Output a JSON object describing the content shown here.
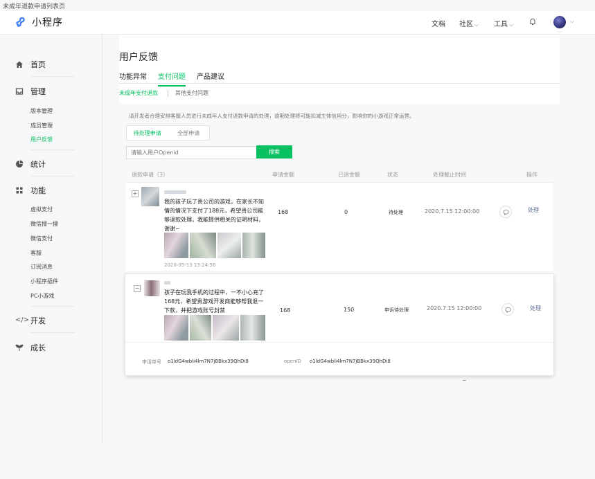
{
  "caption": "未成年退款申请列表页",
  "header": {
    "logo_text": "小程序",
    "links": [
      {
        "label": "文档",
        "has_dropdown": false
      },
      {
        "label": "社区",
        "has_dropdown": true
      },
      {
        "label": "工具",
        "has_dropdown": true
      }
    ],
    "bell_icon": "bell-icon",
    "avatar_icon": "user-avatar"
  },
  "sidebar": {
    "home": {
      "label": "首页",
      "icon": "home-icon"
    },
    "manage": {
      "label": "管理",
      "icon": "inbox-icon",
      "items": [
        "版本管理",
        "成员管理",
        "用户反馈"
      ],
      "active_index": 2
    },
    "stats": {
      "label": "统计",
      "icon": "pie-chart-icon"
    },
    "features": {
      "label": "功能",
      "icon": "grid-icon",
      "items": [
        "虚拟支付",
        "微信搜一搜",
        "微信支付",
        "客服",
        "订阅消息",
        "小程序插件",
        "PC小游戏"
      ]
    },
    "dev": {
      "label": "开发",
      "icon": "code-icon"
    },
    "growth": {
      "label": "成长",
      "icon": "sprout-icon"
    }
  },
  "main": {
    "title": "用户反馈",
    "tabs": [
      {
        "label": "功能异常",
        "active": false
      },
      {
        "label": "支付问题",
        "active": true
      },
      {
        "label": "产品建议",
        "active": false
      }
    ],
    "subtabs": [
      {
        "label": "未成年支付退款",
        "active": true
      },
      {
        "label": "其他支付问题",
        "active": false
      }
    ],
    "notice": "请开发者合理安排客服人员进行未成年人支付退款申请的处理，逾期处理将可能扣减主体信用分，影响你的小游戏正常运营。",
    "segments": [
      {
        "label": "待处理申请",
        "active": true
      },
      {
        "label": "全部申请",
        "active": false
      }
    ],
    "search": {
      "placeholder": "请输入用户Openid",
      "button": "搜索"
    },
    "table": {
      "headers": [
        "退款申请（3）",
        "申请金额",
        "已退金额",
        "状态",
        "处理截止时间",
        "操作"
      ],
      "rows": [
        {
          "expand_symbol": "+",
          "text": "我的孩子玩了贵公司的游戏，在家长不知情的情况下支付了188元，希望贵公司能够退款处理，我能提供相关的证明材料，谢谢~",
          "date": "2020-05-13 13:24:56",
          "amount": "168",
          "refunded": "0",
          "status": "待处理",
          "deadline": "2020.7.15 12:00:00",
          "action": "处理"
        },
        {
          "expand_symbol": "−",
          "text": "孩子在玩我手机的过程中，一不小心充了168元，希望贵游戏开发商能够帮我退一下款，并把游戏账号封禁",
          "amount": "168",
          "refunded": "150",
          "status": "申诉待处理",
          "deadline": "2020.7.15 12:00:00",
          "action": "处理",
          "details": {
            "order_label": "申请单号",
            "order_value": "o1ldG4wbli4lm7N7jBBkx39QhDi8",
            "openid_label": "openID",
            "openid_value": "o1ldG4wbli4lm7N7jBBkx39QhDi8"
          }
        }
      ]
    }
  },
  "colors": {
    "accent": "#07c160",
    "link": "#576b95"
  }
}
